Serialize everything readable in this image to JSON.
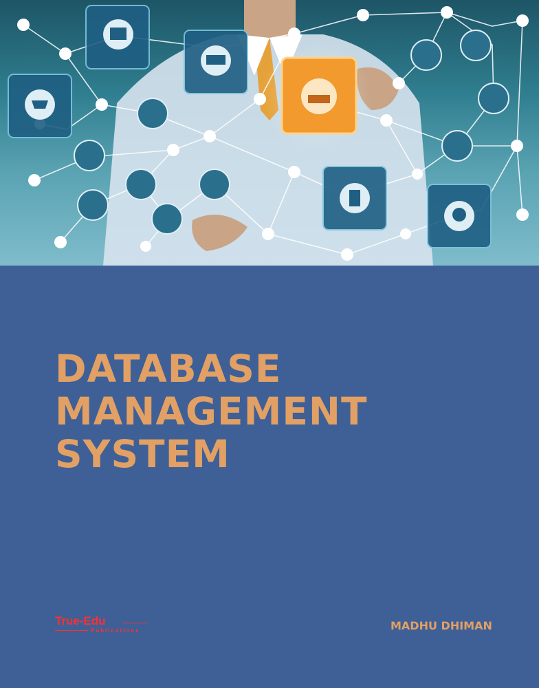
{
  "hero": {
    "icons": [
      "shop-icon",
      "ambulance-icon",
      "factory-robot-icon",
      "shopping-cart-icon",
      "target-icon",
      "test-tube-icon",
      "brain-circuit-icon",
      "pills-icon",
      "flask-icon",
      "cloud-data-icon",
      "medicine-bottle-icon",
      "brain-head-icon",
      "analytics-chart-icon",
      "document-icon",
      "team-icon",
      "lab-tubes-icon"
    ]
  },
  "cover": {
    "title_lines": [
      "DATABASE",
      "MANAGEMENT",
      "SYSTEM"
    ],
    "author": "MADHU DHIMAN"
  },
  "publisher": {
    "name": "True-Edu",
    "subtitle": "Publications"
  },
  "colors": {
    "background": "#3e6096",
    "title": "#e2a065",
    "publisher": "#ff3030",
    "node": "#ffffff",
    "highlight_tile": "#f29a2e",
    "tile": "#1f5f83"
  }
}
